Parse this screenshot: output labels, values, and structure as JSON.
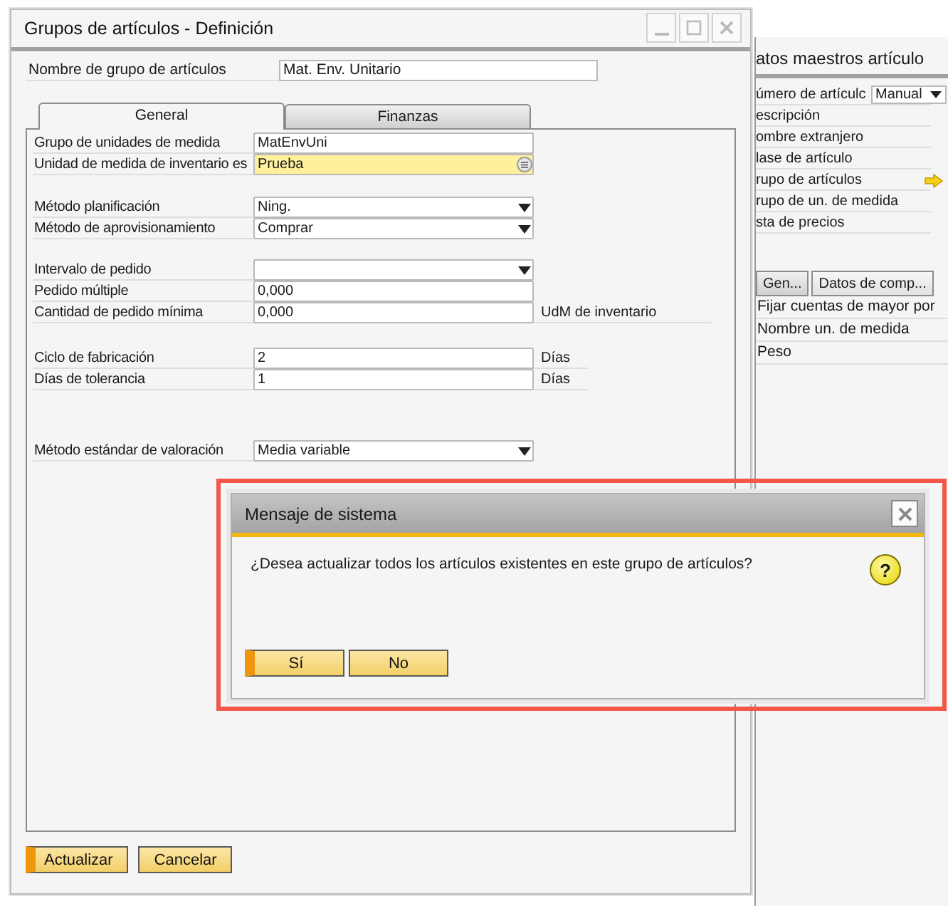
{
  "main_window": {
    "title": "Grupos de artículos - Definición",
    "name_field": {
      "label": "Nombre de grupo de artículos",
      "value": "Mat. Env. Unitario"
    },
    "tabs": [
      {
        "label": "General",
        "selected": true
      },
      {
        "label": "Finanzas",
        "selected": false
      }
    ],
    "field_groups": [
      [
        {
          "kind": "text",
          "label": "Grupo de unidades de medida",
          "value": "MatEnvUni"
        },
        {
          "kind": "lookup",
          "label": "Unidad de medida de inventario es",
          "value": "Prueba"
        }
      ],
      [
        {
          "kind": "select",
          "label": "Método planificación",
          "value": "Ning."
        },
        {
          "kind": "select",
          "label": "Método de aprovisionamiento",
          "value": "Comprar"
        }
      ],
      [
        {
          "kind": "select",
          "label": "Intervalo de pedido"
        },
        {
          "kind": "text",
          "label": "Pedido múltiple",
          "value": "0,000"
        },
        {
          "kind": "text",
          "label": "Cantidad de pedido mínima",
          "value": "0,000",
          "unit": "UdM de inventario"
        }
      ],
      [
        {
          "kind": "text",
          "label": "Ciclo de fabricación",
          "value": "2",
          "unit": "Días"
        },
        {
          "kind": "text",
          "label": "Días de tolerancia",
          "value": "1",
          "unit": "Días"
        }
      ],
      [
        {
          "kind": "select",
          "label": "Método estándar de valoración",
          "value": "Media variable"
        }
      ]
    ],
    "buttons": [
      {
        "label": "Actualizar",
        "default": true
      },
      {
        "label": "Cancelar",
        "default": false
      }
    ]
  },
  "back_window": {
    "title": "atos maestros artículo",
    "rows": [
      {
        "label": "úmero de artículc",
        "select": "Manual"
      },
      {
        "label": "escripción"
      },
      {
        "label": "ombre extranjero"
      },
      {
        "label": "lase de artículo"
      },
      {
        "label": "rupo de artículos",
        "link": true
      },
      {
        "label": "rupo de un. de medida"
      },
      {
        "label": "sta de precios"
      }
    ],
    "tabs": [
      {
        "label": "Gen...",
        "selected": false
      },
      {
        "label": "Datos de comp...",
        "selected": true
      }
    ],
    "texts": [
      "Fijar cuentas de mayor por",
      "Nombre un. de medida",
      "Peso"
    ]
  },
  "dialog": {
    "title": "Mensaje de sistema",
    "message": "¿Desea actualizar todos los artículos existentes en este grupo de artículos?",
    "icon_text": "?",
    "buttons": [
      {
        "label": "Sí",
        "default": true
      },
      {
        "label": "No",
        "default": false
      }
    ]
  }
}
